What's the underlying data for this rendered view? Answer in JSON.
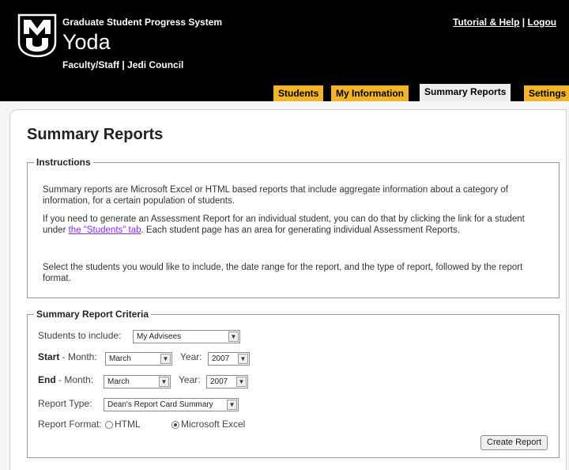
{
  "header": {
    "system_title": "Graduate Student Progress System",
    "user_name": "Yoda",
    "user_roles": "Faculty/Staff | Jedi Council",
    "links": {
      "tutorial": "Tutorial & Help",
      "separator": " | ",
      "logout": "Logou"
    }
  },
  "tabs": [
    {
      "label": "Students",
      "active": false
    },
    {
      "label": "My Information",
      "active": false
    },
    {
      "label": "Summary Reports",
      "active": true
    },
    {
      "label": "Settings",
      "active": false
    }
  ],
  "page": {
    "title": "Summary Reports"
  },
  "instructions": {
    "legend": "Instructions",
    "p1": "Summary reports are Microsoft Excel or HTML based reports that include aggregate information about a category of information, for a certain population of students.",
    "p2_before": "If you need to generate an Assessment Report for an individual student, you can do that by clicking the link for a student under ",
    "p2_link": "the \"Students\" tab",
    "p2_after": ". Each student page has an area for generating individual Assessment Reports.",
    "p3": "Select the students you would like to include, the date range for the report, and the type of report, followed by the report format."
  },
  "criteria": {
    "legend": "Summary Report Criteria",
    "students_label": "Students to include:",
    "students_value": "My Advisees",
    "start_label": "Start",
    "end_label": "End",
    "month_label": " - Month:",
    "year_label": "Year:",
    "start_month": "March",
    "start_year": "2007",
    "end_month": "March",
    "end_year": "2007",
    "report_type_label": "Report Type:",
    "report_type_value": "Dean's Report Card Summary",
    "report_format_label": "Report Format:",
    "format_html": "HTML",
    "format_excel": "Microsoft Excel",
    "selected_format": "Microsoft Excel",
    "create_button": "Create Report"
  }
}
